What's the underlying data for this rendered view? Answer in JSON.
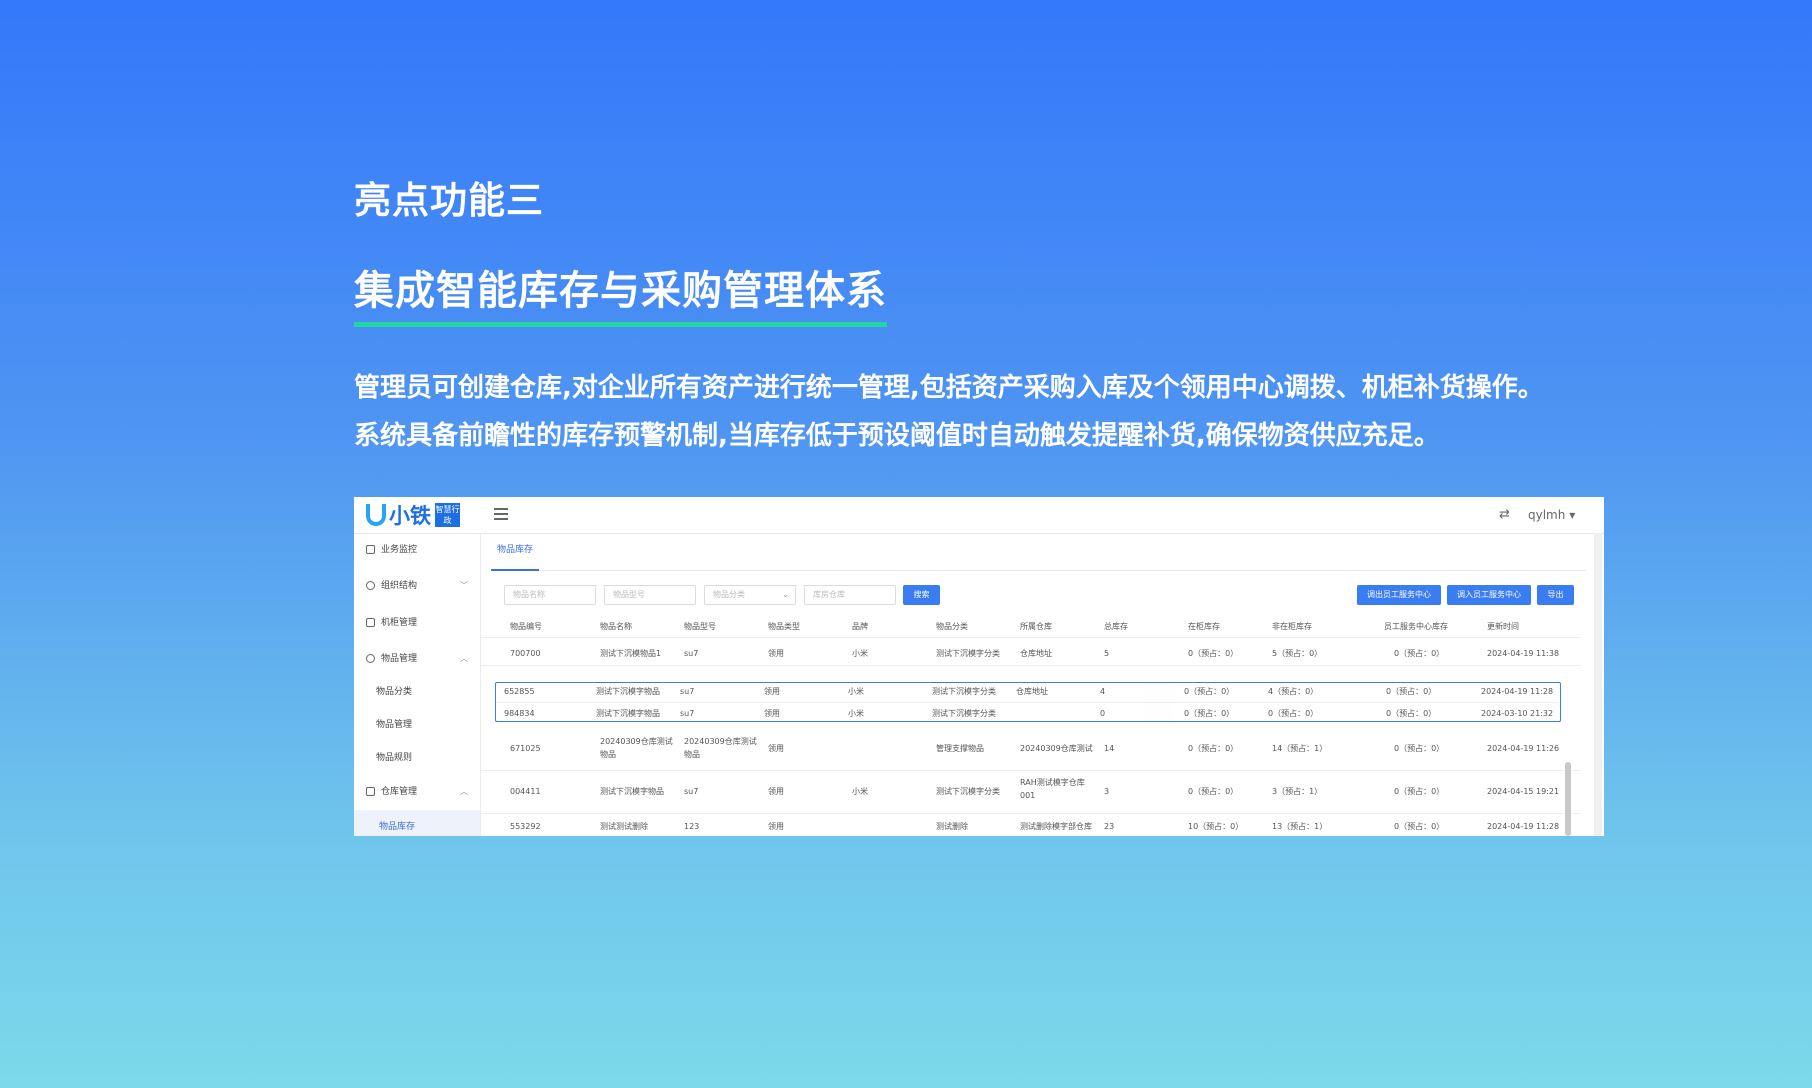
{
  "hero": {
    "kicker": "亮点功能三",
    "title": "集成智能库存与采购管理体系",
    "desc_line1": "管理员可创建仓库,对企业所有资产进行统一管理,包括资产采购入库及个领用中心调拨、机柜补货操作。",
    "desc_line2": "系统具备前瞻性的库存预警机制,当库存低于预设阈值时自动触发提醒补货,确保物资供应充足。"
  },
  "app": {
    "logo_text": "小铁",
    "logo_badge": "智慧行政",
    "user": "qylmh",
    "translate_icon": "translate-icon"
  },
  "sidebar": {
    "items": [
      {
        "label": "业务监控",
        "icon": "monitor-icon"
      },
      {
        "label": "组织结构",
        "icon": "org-icon"
      },
      {
        "label": "机柜管理",
        "icon": "cabinet-icon"
      },
      {
        "label": "物品管理",
        "icon": "box-icon"
      },
      {
        "label": "仓库管理",
        "icon": "home-icon"
      }
    ],
    "sub_items": [
      "物品分类",
      "物品管理",
      "物品规则"
    ],
    "active": "物品库存"
  },
  "tab": "物品库存",
  "filters": {
    "name": "物品名称",
    "model": "物品型号",
    "category": "物品分类",
    "warehouse": "库房仓库"
  },
  "buttons": {
    "search": "搜索",
    "transfer_out": "调出员工服务中心",
    "transfer_in": "调入员工服务中心",
    "export": "导出"
  },
  "table": {
    "headers": [
      "物品编号",
      "物品名称",
      "物品型号",
      "物品类型",
      "品牌",
      "物品分类",
      "所属仓库",
      "总库存",
      "在柜库存",
      "非在柜库存",
      "员工服务中心库存",
      "更新时间"
    ],
    "rows": [
      [
        "700700",
        "测试下沉模物品1",
        "su7",
        "领用",
        "小米",
        "测试下沉模字分类",
        "仓库地址",
        "5",
        "0（预占：0）",
        "5（预占：0）",
        "0（预占：0）",
        "2024-04-19 11:38"
      ],
      [
        "652855",
        "测试下沉模字物品",
        "su7",
        "领用",
        "小米",
        "测试下沉模字分类",
        "仓库地址",
        "4",
        "0（预占：0）",
        "4（预占：0）",
        "0（预占：0）",
        "2024-04-19 11:28"
      ],
      [
        "984834",
        "测试下沉模字物品",
        "su7",
        "领用",
        "小米",
        "测试下沉模字分类",
        "",
        "0",
        "0（预占：0）",
        "0（预占：0）",
        "0（预占：0）",
        "2024-03-10 21:32"
      ],
      [
        "671025",
        "20240309仓库测试物品",
        "20240309仓库测试物品",
        "领用",
        "",
        "管理支撑物品",
        "20240309仓库测试",
        "14",
        "0（预占：0）",
        "14（预占：1）",
        "0（预占：0）",
        "2024-04-19 11:26"
      ],
      [
        "004411",
        "测试下沉模字物品",
        "su7",
        "领用",
        "小米",
        "测试下沉模字分类",
        "RAH测试模字仓库001",
        "3",
        "0（预占：0）",
        "3（预占：1）",
        "0（预占：0）",
        "2024-04-15 19:21"
      ],
      [
        "553292",
        "测试测试删除",
        "123",
        "领用",
        "",
        "测试删除",
        "测试删除模字部仓库",
        "23",
        "10（预占：0）",
        "13（预占：1）",
        "0（预占：0）",
        "2024-04-19 11:28"
      ]
    ]
  }
}
